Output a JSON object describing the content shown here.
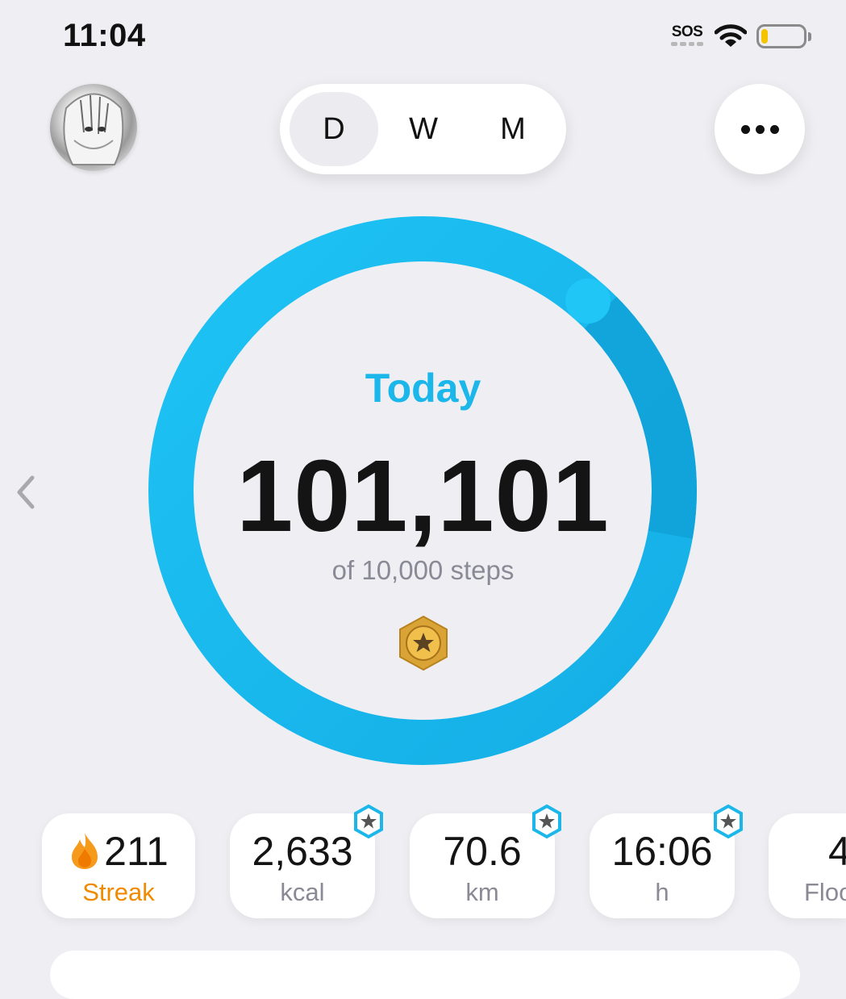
{
  "status_bar": {
    "time": "11:04",
    "sos": "SOS",
    "battery_level": 0.15
  },
  "header": {
    "segments": [
      "D",
      "W",
      "M"
    ],
    "selected_segment": "D"
  },
  "summary": {
    "title": "Today",
    "steps": "101,101",
    "goal_text": "of 10,000 steps",
    "goal_progress": 1.0
  },
  "stats": [
    {
      "value": "211",
      "label": "Streak",
      "icon": "flame-icon",
      "badge": false
    },
    {
      "value": "2,633",
      "label": "kcal",
      "badge": true
    },
    {
      "value": "70.6",
      "label": "km",
      "badge": true
    },
    {
      "value": "16:06",
      "label": "h",
      "badge": true
    },
    {
      "value": "4",
      "label": "Floo",
      "badge": false
    }
  ],
  "colors": {
    "accent": "#1bb6ea",
    "ring": "#1ec0f2",
    "streak": "#f08a00",
    "background": "#efeff3"
  }
}
